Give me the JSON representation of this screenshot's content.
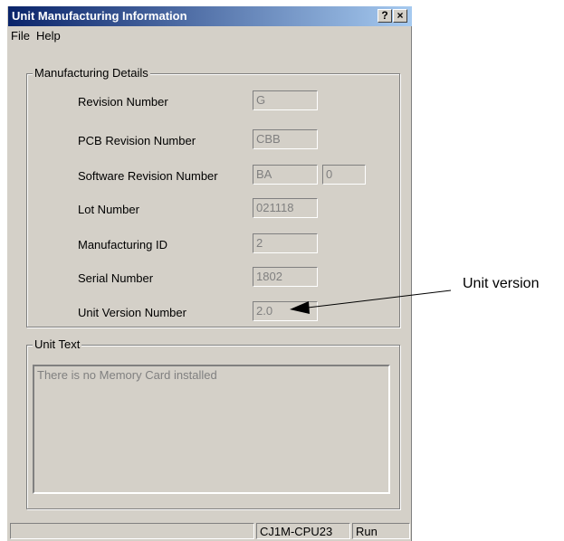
{
  "window": {
    "title": "Unit Manufacturing Information",
    "help_btn": "?",
    "close_btn": "×"
  },
  "menu": {
    "file": "File",
    "help": "Help"
  },
  "details": {
    "legend": "Manufacturing Details",
    "revision_label": "Revision Number",
    "revision_value": "G",
    "pcb_label": "PCB Revision Number",
    "pcb_value": "CBB",
    "software_label": "Software Revision Number",
    "software_value": "BA",
    "software_value2": "0",
    "lot_label": "Lot Number",
    "lot_value": "021118",
    "mfg_label": "Manufacturing ID",
    "mfg_value": "2",
    "serial_label": "Serial Number",
    "serial_value": "1802",
    "unitver_label": "Unit Version Number",
    "unitver_value": "2.0"
  },
  "unit_text": {
    "legend": "Unit Text",
    "content": "There is no Memory Card installed"
  },
  "status": {
    "model": "CJ1M-CPU23",
    "mode": "Run"
  },
  "annotation": {
    "label": "Unit version"
  }
}
